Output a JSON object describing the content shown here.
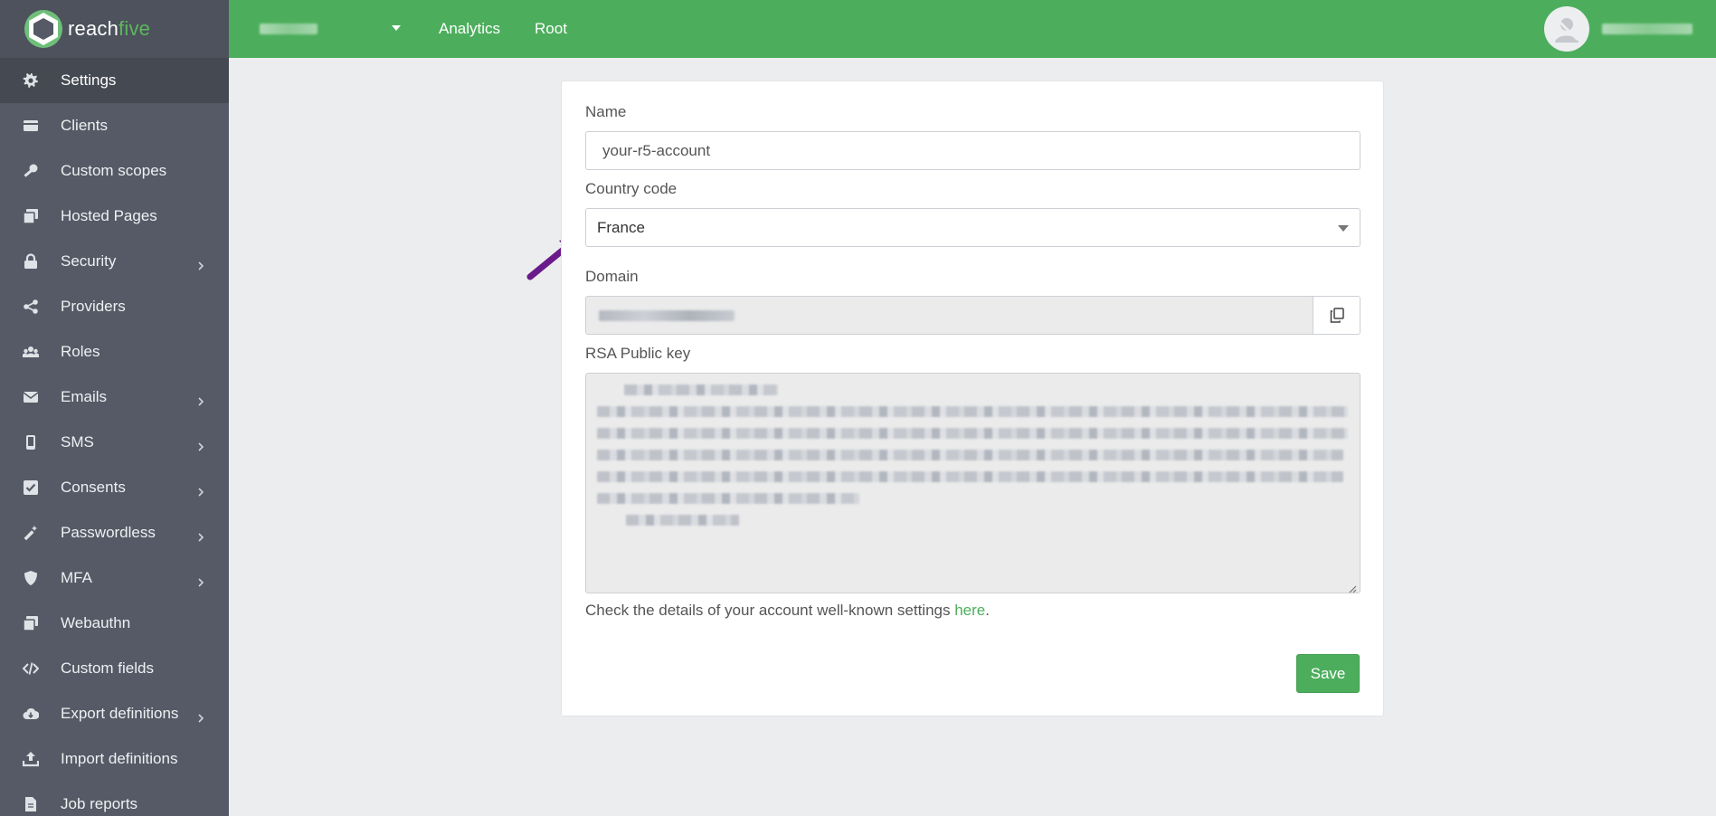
{
  "brand": {
    "name_part1": "reach",
    "name_part2": "five",
    "accent": "#4cae5c"
  },
  "sidebar": {
    "items": [
      {
        "label": "Settings",
        "icon": "gear-icon",
        "active": true,
        "has_submenu": false
      },
      {
        "label": "Clients",
        "icon": "card-icon",
        "active": false,
        "has_submenu": false
      },
      {
        "label": "Custom scopes",
        "icon": "key-icon",
        "active": false,
        "has_submenu": false
      },
      {
        "label": "Hosted Pages",
        "icon": "pages-icon",
        "active": false,
        "has_submenu": false
      },
      {
        "label": "Security",
        "icon": "lock-icon",
        "active": false,
        "has_submenu": true
      },
      {
        "label": "Providers",
        "icon": "share-icon",
        "active": false,
        "has_submenu": false
      },
      {
        "label": "Roles",
        "icon": "users-icon",
        "active": false,
        "has_submenu": false
      },
      {
        "label": "Emails",
        "icon": "envelope-icon",
        "active": false,
        "has_submenu": true
      },
      {
        "label": "SMS",
        "icon": "mobile-icon",
        "active": false,
        "has_submenu": true
      },
      {
        "label": "Consents",
        "icon": "checkbox-icon",
        "active": false,
        "has_submenu": true
      },
      {
        "label": "Passwordless",
        "icon": "magic-wand-icon",
        "active": false,
        "has_submenu": true
      },
      {
        "label": "MFA",
        "icon": "shield-icon",
        "active": false,
        "has_submenu": true
      },
      {
        "label": "Webauthn",
        "icon": "pages-icon",
        "active": false,
        "has_submenu": false
      },
      {
        "label": "Custom fields",
        "icon": "code-icon",
        "active": false,
        "has_submenu": false
      },
      {
        "label": "Export definitions",
        "icon": "cloud-download-icon",
        "active": false,
        "has_submenu": true
      },
      {
        "label": "Import definitions",
        "icon": "upload-icon",
        "active": false,
        "has_submenu": false
      },
      {
        "label": "Job reports",
        "icon": "file-icon",
        "active": false,
        "has_submenu": false
      }
    ]
  },
  "topbar": {
    "links": [
      "Analytics",
      "Root"
    ],
    "bg_color": "#4cae5c"
  },
  "form": {
    "name_label": "Name",
    "name_value": "your-r5-account",
    "country_label": "Country code",
    "country_value": "France",
    "domain_label": "Domain",
    "rsa_label": "RSA Public key",
    "help_prefix": "Check the details of your account well-known settings ",
    "help_link": "here",
    "help_suffix": ".",
    "save_label": "Save"
  },
  "annotation": {
    "arrow_color": "#6a1b8a"
  }
}
